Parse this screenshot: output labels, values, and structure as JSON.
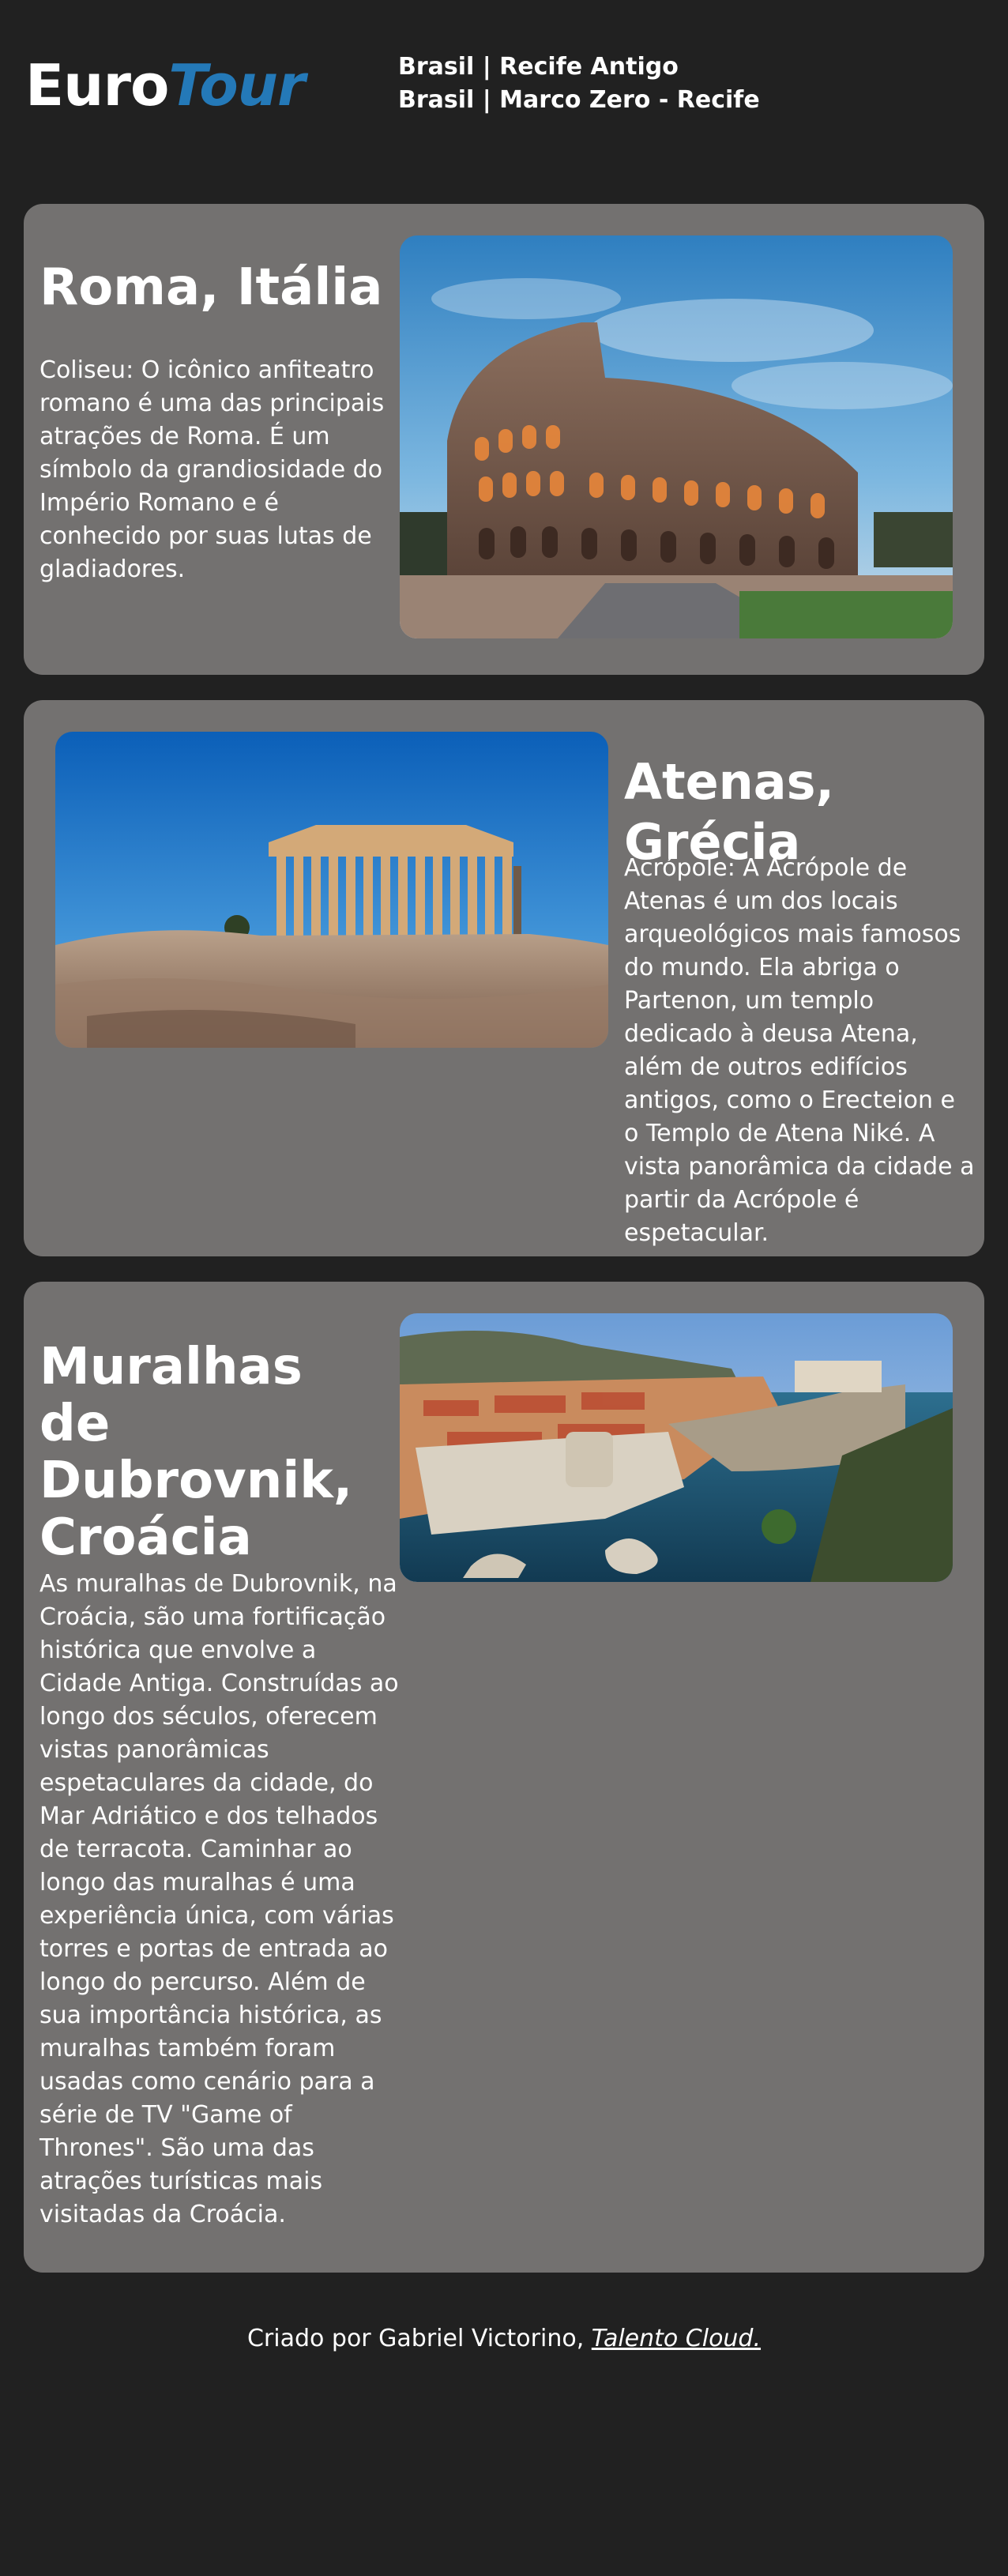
{
  "header": {
    "logo_part1": "Euro",
    "logo_part2": "Tour",
    "links": [
      "Brasil | Recife Antigo",
      "Brasil | Marco Zero - Recife"
    ]
  },
  "cards": [
    {
      "title": "Roma, Itália",
      "text": "Coliseu: O icônico anfiteatro romano é uma das principais atrações de Roma. É um símbolo da grandiosidade do Império Romano e é conhecido por suas lutas de gladiadores.",
      "image": "colosseum-photo"
    },
    {
      "title": "Atenas, Grécia",
      "text": "Acrópole: A Acrópole de Atenas é um dos locais arqueológicos mais famosos do mundo. Ela abriga o Partenon, um templo dedicado à deusa Atena, além de outros edifícios antigos, como o Erecteion e o Templo de Atena Niké. A vista panorâmica da cidade a partir da Acrópole é espetacular.",
      "image": "parthenon-photo"
    },
    {
      "title": "Muralhas de Dubrovnik, Croácia",
      "text": "As muralhas de Dubrovnik, na Croácia, são uma fortificação histórica que envolve a Cidade Antiga. Construídas ao longo dos séculos, oferecem vistas panorâmicas espetaculares da cidade, do Mar Adriático e dos telhados de terracota. Caminhar ao longo das muralhas é uma experiência única, com várias torres e portas de entrada ao longo do percurso. Além de sua importância histórica, as muralhas também foram usadas como cenário para a série de TV \"Game of Thrones\". São uma das atrações turísticas mais visitadas da Croácia.",
      "image": "dubrovnik-photo"
    }
  ],
  "footer": {
    "prefix": "Criado por Gabriel Victorino, ",
    "link": "Talento Cloud."
  },
  "colors": {
    "background": "#212121",
    "card": "#737170",
    "accent": "#2479b8",
    "text": "#ffffff"
  }
}
